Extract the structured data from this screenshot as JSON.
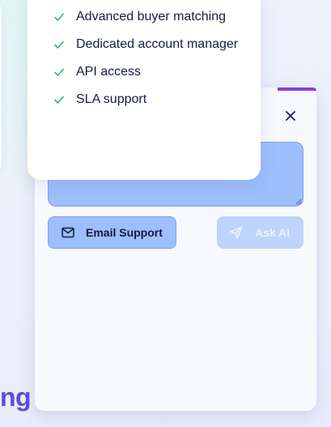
{
  "features": {
    "items": [
      {
        "label": "Advanced buyer matching"
      },
      {
        "label": "Dedicated account manager"
      },
      {
        "label": "API access"
      },
      {
        "label": "SLA support"
      }
    ],
    "check_color": "#2fb67a"
  },
  "help_panel": {
    "close_label": "×",
    "question_input": {
      "value": "",
      "placeholder": ""
    },
    "email_support_label": "Email Support",
    "ask_ai_label": "Ask AI",
    "accent_color": "#8b3fd9"
  },
  "background": {
    "heading_fragment": "ng"
  }
}
